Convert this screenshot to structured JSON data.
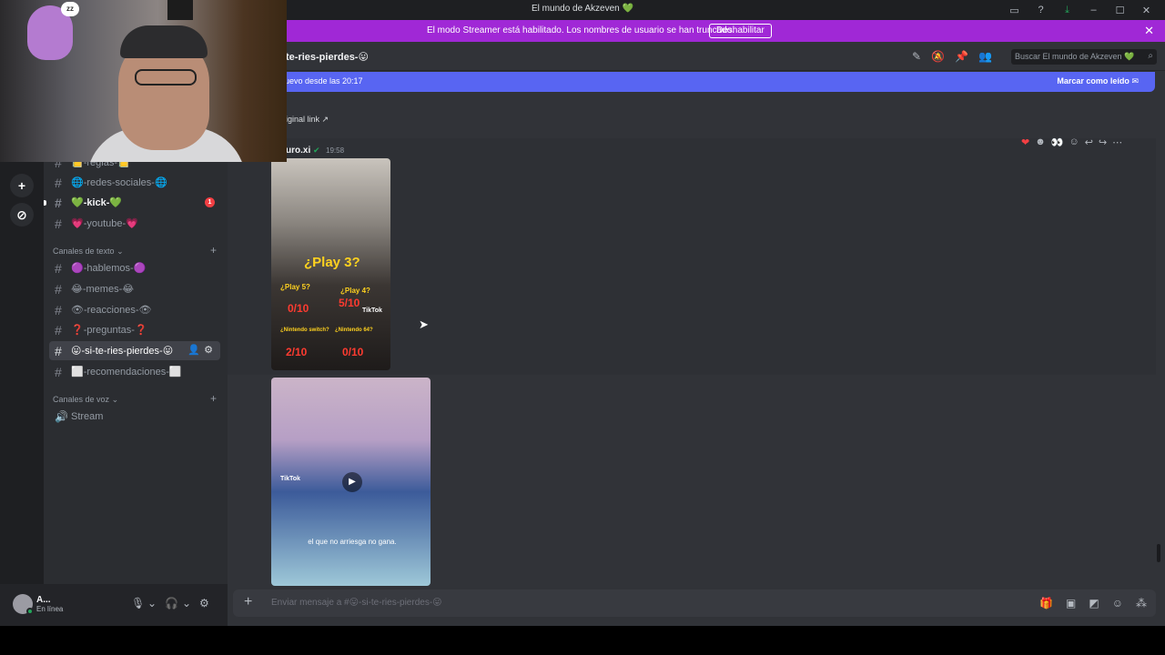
{
  "window": {
    "title": "El mundo de Akzeven 💚",
    "icons": [
      "inbox-icon",
      "help-icon",
      "download-icon",
      "minimize-icon",
      "maximize-icon",
      "close-icon"
    ]
  },
  "streamer_banner": {
    "message": "El modo Streamer está habilitado. Los nombres de usuario se han truncado.",
    "button": "Deshabilitar",
    "close": "✕"
  },
  "sidebar": {
    "channels_top": [
      {
        "label": "📒-reglas-📒",
        "unread": false
      },
      {
        "label": "🌐-redes-sociales-🌐",
        "unread": false
      },
      {
        "label": "💚-kick-💚",
        "unread": true,
        "badge": "1"
      },
      {
        "label": "💗-youtube-💗",
        "unread": false
      }
    ],
    "text_category": "Canales de texto",
    "text_channels": [
      {
        "label": "🟣-hablemos-🟣",
        "active": false
      },
      {
        "label": "😂-memes-😂",
        "active": false
      },
      {
        "label": "👁-reacciones-👁",
        "active": false
      },
      {
        "label": "❓-preguntas-❓",
        "active": false
      },
      {
        "label": "😛-si-te-ries-pierdes-😛",
        "active": true
      },
      {
        "label": "⬜-recomendaciones-⬜",
        "active": false
      }
    ],
    "voice_category": "Canales de voz",
    "voice_channels": [
      {
        "label": "Stream"
      }
    ]
  },
  "user_panel": {
    "name": "A...",
    "status": "En línea"
  },
  "channel_header": {
    "name": "te-ries-pierdes-😛",
    "search_placeholder": "Buscar El mundo de Akzeven 💚"
  },
  "new_messages_bar": {
    "left": "uevo desde las 20:17",
    "right": "Marcar como leído"
  },
  "messages": {
    "link_text": "iginal link",
    "author": "uro.xi",
    "timestamp": "19:58",
    "image1": {
      "title": "¿Play 3?",
      "labels": [
        {
          "text": "¿Play 5?",
          "rating": "0/10"
        },
        {
          "text": "¿Play 4?",
          "rating": "5/10"
        },
        {
          "text": "¿Nintendo switch?",
          "rating": "2/10"
        },
        {
          "text": "¿Nintendo 64?",
          "rating": "0/10"
        }
      ],
      "watermark": "TikTok"
    },
    "image2": {
      "watermark": "TikTok",
      "caption": "el que no arriesga no gana."
    }
  },
  "composer": {
    "placeholder": "Enviar mensaje a #😛-si-te-ries-pierdes-😛"
  },
  "colors": {
    "streamer_banner": "#a028d6",
    "new_messages": "#5865f2",
    "background": "#313338",
    "sidebar": "#2b2d31"
  }
}
